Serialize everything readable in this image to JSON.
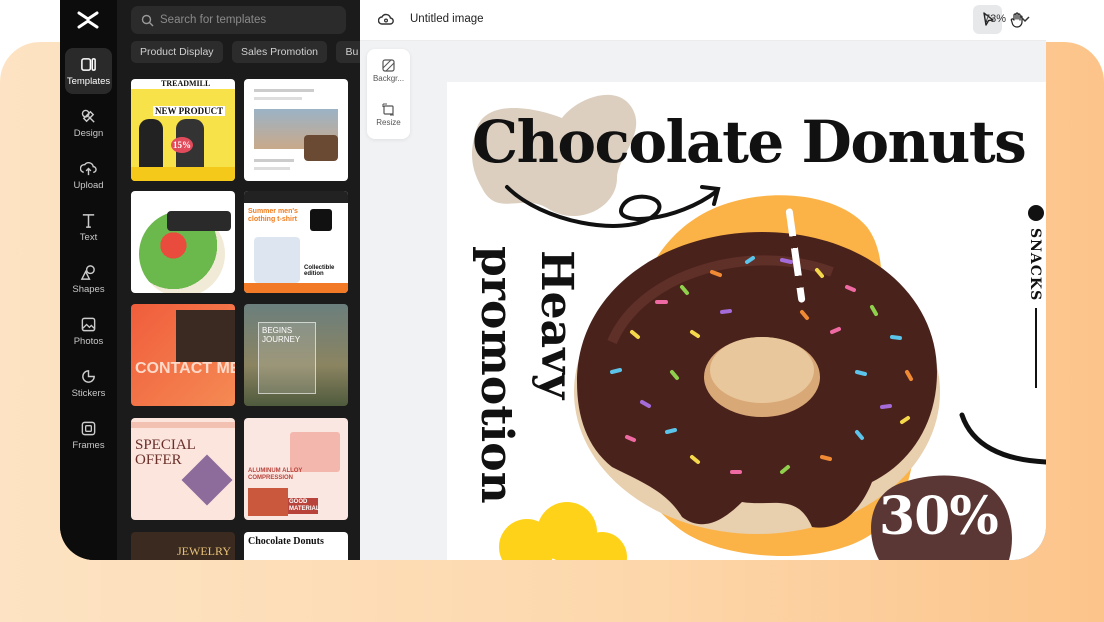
{
  "app": {
    "document_title": "Untitled image",
    "zoom": "73%"
  },
  "rail": [
    {
      "label": "Templates",
      "icon": "templates-icon",
      "active": true
    },
    {
      "label": "Design",
      "icon": "design-icon"
    },
    {
      "label": "Upload",
      "icon": "upload-icon"
    },
    {
      "label": "Text",
      "icon": "text-icon"
    },
    {
      "label": "Shapes",
      "icon": "shapes-icon"
    },
    {
      "label": "Photos",
      "icon": "photos-icon"
    },
    {
      "label": "Stickers",
      "icon": "stickers-icon"
    },
    {
      "label": "Frames",
      "icon": "frames-icon"
    }
  ],
  "panel": {
    "search_placeholder": "Search for templates",
    "chips": [
      "Product Display",
      "Sales Promotion",
      "Bu"
    ],
    "templates": [
      {
        "name": "treadmill",
        "lines": [
          "TREADMILL",
          "NEW PRODUCT",
          "15%"
        ]
      },
      {
        "name": "travel-listing",
        "lines": []
      },
      {
        "name": "salad-post",
        "lines": []
      },
      {
        "name": "tshirt",
        "lines": [
          "Summer men's clothing t-shirt",
          "Collectible edition"
        ]
      },
      {
        "name": "contact-me",
        "lines": [
          "CONTACT ME"
        ]
      },
      {
        "name": "begins-journey",
        "lines": [
          "BEGINS JOURNEY"
        ]
      },
      {
        "name": "special-offer",
        "lines": [
          "SPECIAL OFFER"
        ]
      },
      {
        "name": "suitcase",
        "lines": [
          "ALUMINUM ALLOY COMPRESSION",
          "GOOD MATERIAL"
        ]
      },
      {
        "name": "jewelry",
        "lines": [
          "JEWELRY"
        ]
      },
      {
        "name": "chocolate-donuts",
        "lines": [
          "Chocolate Donuts"
        ]
      }
    ]
  },
  "side_tools": {
    "background": "Backgr...",
    "resize": "Resize"
  },
  "artboard": {
    "headline": "Chocolate Donuts",
    "vertical_1": "Heavy",
    "vertical_2": "promotion",
    "snacks": "SNACKS",
    "discount": "30%"
  },
  "colors": {
    "accent_orange": "#fbb347",
    "beige_blob": "#dccfc0",
    "brown_badge": "#5a3735",
    "yellow_flower": "#ffd21a"
  }
}
